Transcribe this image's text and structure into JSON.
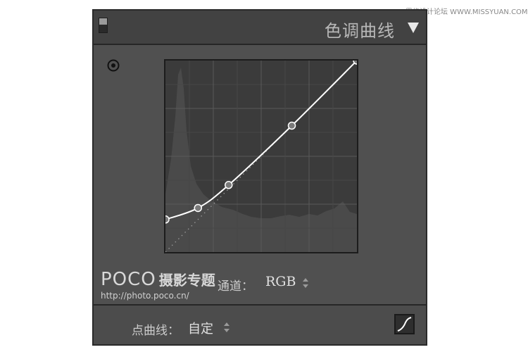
{
  "watermark": {
    "top_right": "思缘设计论坛 WWW.MISSYUAN.COM"
  },
  "panel": {
    "title": "色调曲线",
    "icons": {
      "toggle": "panel-toggle-switch",
      "collapse": "triangle-down-icon",
      "target": "targeted-adjustment-icon",
      "curve_mode": "point-curve-icon"
    }
  },
  "curve": {
    "points": [
      [
        0,
        0.17
      ],
      [
        0.17,
        0.23
      ],
      [
        0.33,
        0.35
      ],
      [
        0.66,
        0.66
      ],
      [
        1.0,
        1.0
      ]
    ],
    "colors": {
      "background": "#3b3b3b",
      "histogram": "#4a4a4a",
      "grid": "#525252",
      "curve": "#ffffff"
    }
  },
  "watermark_logo": {
    "name": "POCO",
    "subtitle": "摄影专题",
    "url": "http://photo.poco.cn/"
  },
  "channel": {
    "label": "通道：",
    "value": "RGB"
  },
  "point_curve": {
    "label": "点曲线：",
    "value": "自定"
  }
}
